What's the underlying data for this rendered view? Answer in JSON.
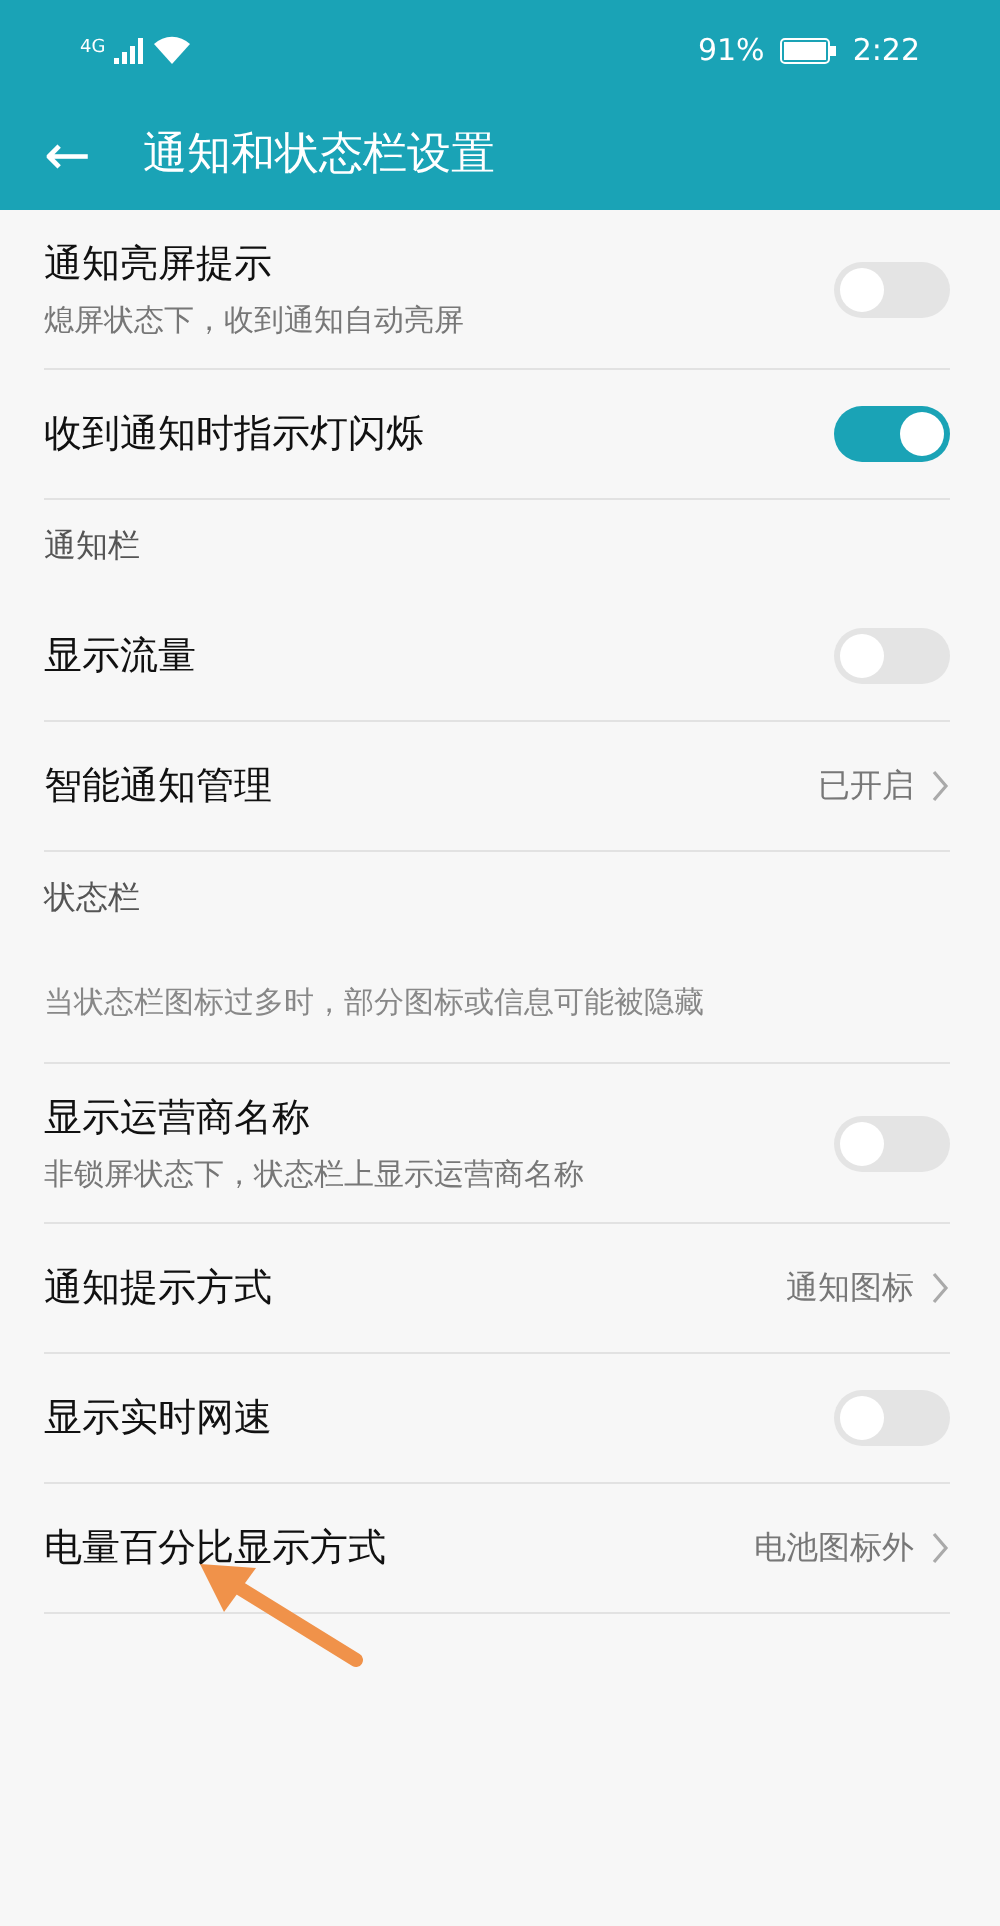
{
  "status_bar": {
    "network": "4G",
    "battery_text": "91%",
    "time": "2:22"
  },
  "header": {
    "back": "←",
    "title": "通知和状态栏设置"
  },
  "items": [
    {
      "kind": "toggle",
      "title": "通知亮屏提示",
      "subtitle": "熄屏状态下，收到通知自动亮屏",
      "on": false
    },
    {
      "kind": "toggle",
      "title": "收到通知时指示灯闪烁",
      "on": true
    },
    {
      "kind": "section",
      "title": "通知栏"
    },
    {
      "kind": "toggle",
      "title": "显示流量",
      "on": false
    },
    {
      "kind": "link",
      "title": "智能通知管理",
      "value": "已开启"
    },
    {
      "kind": "section",
      "title": "状态栏"
    },
    {
      "kind": "note",
      "title": "当状态栏图标过多时，部分图标或信息可能被隐藏"
    },
    {
      "kind": "toggle",
      "title": "显示运营商名称",
      "subtitle": "非锁屏状态下，状态栏上显示运营商名称",
      "on": false
    },
    {
      "kind": "link",
      "title": "通知提示方式",
      "value": "通知图标"
    },
    {
      "kind": "toggle",
      "title": "显示实时网速",
      "on": false
    },
    {
      "kind": "link",
      "title": "电量百分比显示方式",
      "value": "电池图标外"
    }
  ]
}
